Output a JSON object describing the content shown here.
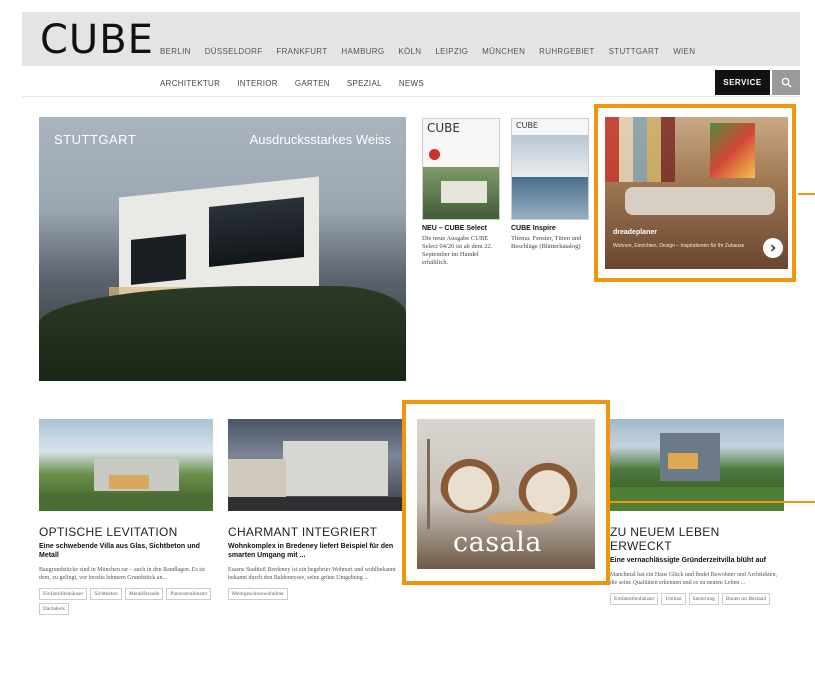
{
  "header": {
    "logo": "CUBE",
    "cities": [
      "BERLIN",
      "DÜSSELDORF",
      "FRANKFURT",
      "HAMBURG",
      "KÖLN",
      "LEIPZIG",
      "MÜNCHEN",
      "RUHRGEBIET",
      "STUTTGART",
      "WIEN"
    ],
    "sections": [
      "ARCHITEKTUR",
      "INTERIOR",
      "GARTEN",
      "SPEZIAL",
      "NEWS"
    ],
    "service_label": "SERVICE"
  },
  "hero": {
    "tag": "STUTTGART",
    "title": "Ausdrucksstarkes Weiss"
  },
  "magazines": [
    {
      "cover_logo": "CUBE",
      "title": "NEU – CUBE Select",
      "text": "Die neue Ausgabe CUBE Select 04/20 ist ab dem 22. September im Handel erhältlich."
    },
    {
      "cover_logo": "CUBE",
      "title": "CUBE Inspire",
      "text": "Thema: Fenster, Türen und Beschläge (Blätterkatalog)"
    }
  ],
  "ad_top": {
    "brand": "dreadeplaner",
    "text": "Wohnen, Einrichten, Design – Inspirationen für Ihr Zuhause"
  },
  "cards": [
    {
      "title": "OPTISCHE LEVITATION",
      "subtitle": "Eine schwebende Villa aus Glas, Sichtbeton und Metall",
      "text": "Baugrundstücke sind in München rar – auch in den Randlagen. Es ist dem, zu gelingt, vor bereits lehmern Grundstück an...",
      "tags": [
        "Einfamilienhäuser",
        "Sichtbeton",
        "Metallfassade",
        "Panoramafenster",
        "Dachdeck"
      ]
    },
    {
      "title": "CHARMANT INTEGRIERT",
      "subtitle": "Wohnkomplex in Bredeney liefert Beispiel für den smarten Umgang mit ...",
      "text": "Essens Stadtteil Bredeney ist ein begehrter Wohnort und wohlbekannt bekannt durch den Baldeneysee, seine grüne Umgebung ...",
      "tags": [
        "Mehrgeschosswohnbau"
      ]
    },
    {
      "title": "ZU NEUEM LEBEN ERWECKT",
      "subtitle": "Eine vernachlässigte Gründerzeitvilla blüht auf",
      "text": "Manchmal hat ein Haus Glück und findet Bewohner und Architekten, die seine Qualitäten erkennen und es zu neuem Leben ...",
      "tags": [
        "Einfamilienhäuser",
        "Umbau",
        "Sanierung",
        "Bauen im Bestand"
      ]
    }
  ],
  "ad_bottom": {
    "brand": "casala"
  }
}
